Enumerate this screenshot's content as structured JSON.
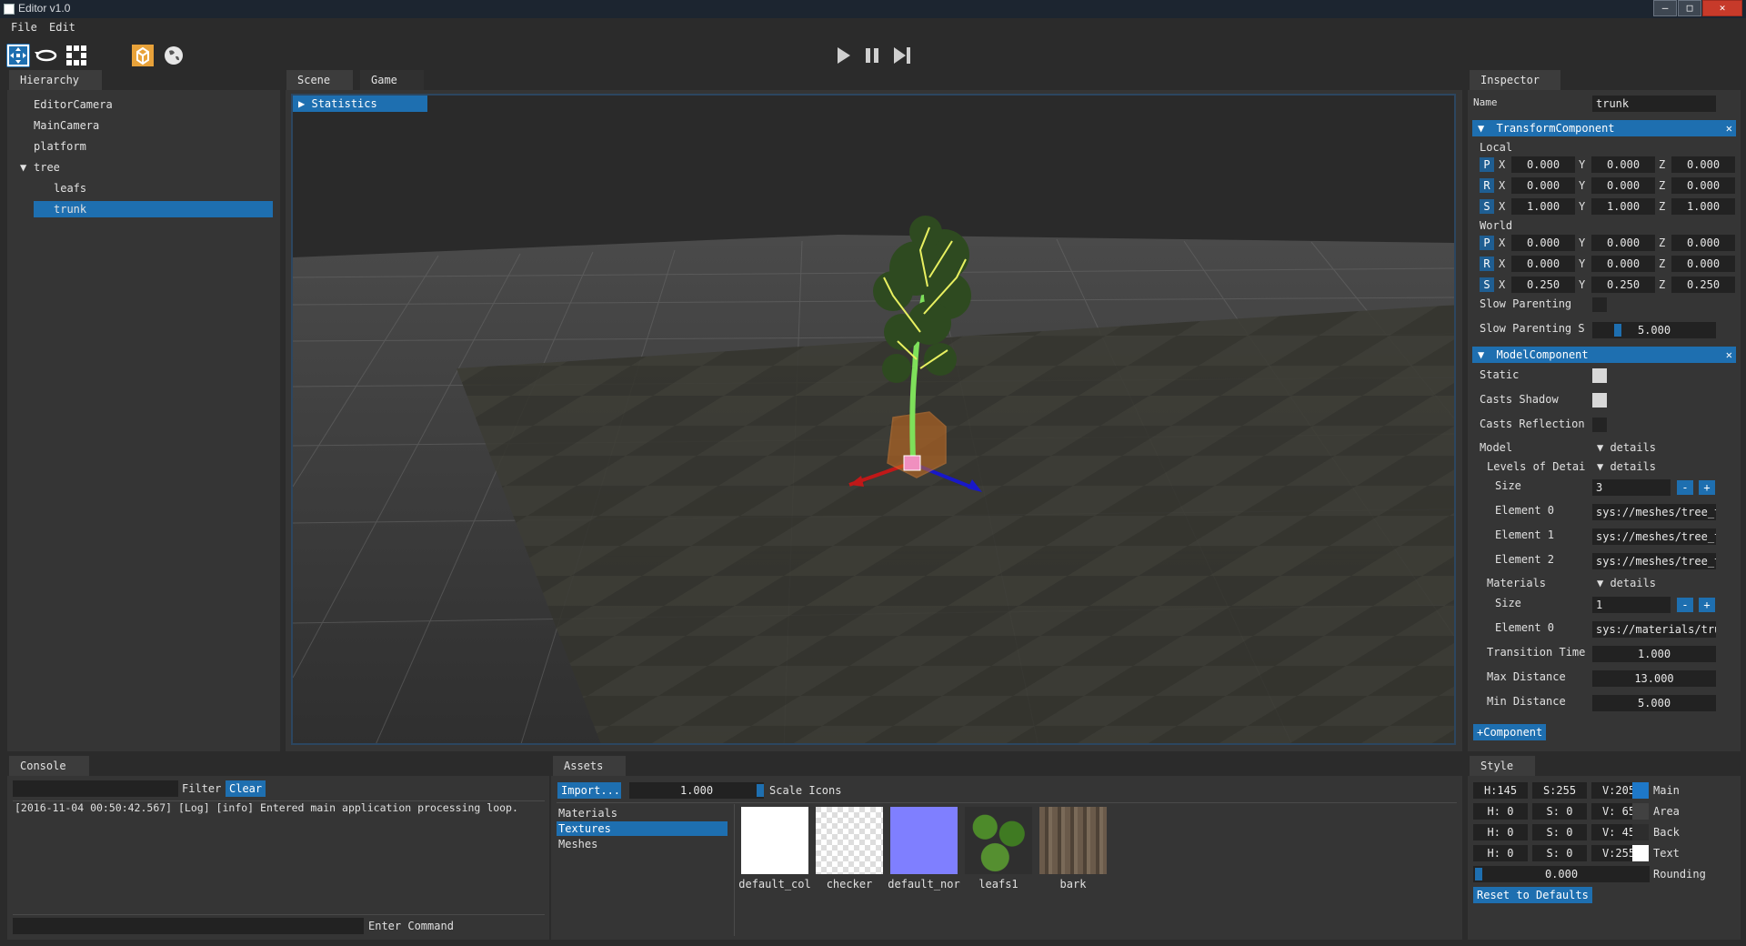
{
  "window": {
    "title": "Editor v1.0",
    "controls": [
      "–",
      "□",
      "✕"
    ]
  },
  "menu": {
    "items": [
      "File",
      "Edit"
    ]
  },
  "toolbar": {
    "tools": [
      "translate-icon",
      "rotate-icon",
      "scale-icon",
      "local-space-icon",
      "world-space-icon"
    ],
    "playback": [
      "play-icon",
      "pause-icon",
      "step-icon"
    ]
  },
  "hierarchy": {
    "tab": "Hierarchy",
    "items": [
      {
        "label": "EditorCamera",
        "depth": 0
      },
      {
        "label": "MainCamera",
        "depth": 0
      },
      {
        "label": "platform",
        "depth": 0
      },
      {
        "label": "tree",
        "depth": 0,
        "expanded": true
      },
      {
        "label": "leafs",
        "depth": 1
      },
      {
        "label": "trunk",
        "depth": 1,
        "selected": true
      }
    ],
    "expand_glyph": "▼"
  },
  "scene": {
    "tabs": [
      "Scene",
      "Game"
    ],
    "statistics_label": "Statistics",
    "statistics_glyph": "▶"
  },
  "inspector": {
    "tab": "Inspector",
    "name_label": "Name",
    "name_value": "trunk",
    "transform": {
      "title": "TransformComponent",
      "local_label": "Local",
      "world_label": "World",
      "axis": [
        "X",
        "Y",
        "Z"
      ],
      "rows_local": [
        {
          "key": "P",
          "values": [
            "0.000",
            "0.000",
            "0.000"
          ]
        },
        {
          "key": "R",
          "values": [
            "0.000",
            "0.000",
            "0.000"
          ]
        },
        {
          "key": "S",
          "values": [
            "1.000",
            "1.000",
            "1.000"
          ]
        }
      ],
      "rows_world": [
        {
          "key": "P",
          "values": [
            "0.000",
            "0.000",
            "0.000"
          ]
        },
        {
          "key": "R",
          "values": [
            "0.000",
            "0.000",
            "0.000"
          ]
        },
        {
          "key": "S",
          "values": [
            "0.250",
            "0.250",
            "0.250"
          ]
        }
      ],
      "slow_parenting_label": "Slow Parenting",
      "slow_parenting_speed_label": "Slow Parenting S",
      "slow_parenting_speed_value": "5.000"
    },
    "model": {
      "title": "ModelComponent",
      "static_label": "Static",
      "casts_shadow_label": "Casts Shadow",
      "casts_reflection_label": "Casts Reflection",
      "model_label": "Model",
      "details_label": "▼ details",
      "lod_label": "Levels of Detai",
      "size_label": "Size",
      "lod_size": "3",
      "lod_elements": [
        {
          "label": "Element 0",
          "value": "sys://meshes/tree_t"
        },
        {
          "label": "Element 1",
          "value": "sys://meshes/tree_t"
        },
        {
          "label": "Element 2",
          "value": "sys://meshes/tree_t"
        }
      ],
      "materials_label": "Materials",
      "materials_size": "1",
      "materials_elements": [
        {
          "label": "Element 0",
          "value": "sys://materials/tru"
        }
      ],
      "transition_time_label": "Transition Time",
      "transition_time_value": "1.000",
      "max_distance_label": "Max Distance",
      "max_distance_value": "13.000",
      "min_distance_label": "Min Distance",
      "min_distance_value": "5.000"
    },
    "add_component_label": "+Component"
  },
  "console": {
    "tab": "Console",
    "filter_label": "Filter",
    "clear_label": "Clear",
    "log_lines": [
      "[2016-11-04 00:50:42.567] [Log] [info] Entered main application processing loop."
    ],
    "command_label": "Enter Command"
  },
  "assets": {
    "tab": "Assets",
    "import_label": "Import...",
    "scale_value": "1.000",
    "scale_label": "Scale Icons",
    "categories": [
      "Materials",
      "Textures",
      "Meshes"
    ],
    "selected_category": "Textures",
    "textures": [
      {
        "label": "default_col",
        "icon": "white-texture"
      },
      {
        "label": "checker",
        "icon": "checker-texture"
      },
      {
        "label": "default_nor",
        "icon": "normal-texture"
      },
      {
        "label": "leafs1",
        "icon": "leaf-texture"
      },
      {
        "label": "bark",
        "icon": "bark-texture"
      }
    ]
  },
  "style": {
    "tab": "Style",
    "rows": [
      {
        "h": "H:145",
        "s": "S:255",
        "v": "V:205",
        "color": "#1e78c8",
        "label": "Main"
      },
      {
        "h": "H:  0",
        "s": "S:  0",
        "v": "V: 65",
        "color": "#414141",
        "label": "Area"
      },
      {
        "h": "H:  0",
        "s": "S:  0",
        "v": "V: 45",
        "color": "#2d2d2d",
        "label": "Back"
      },
      {
        "h": "H:  0",
        "s": "S:  0",
        "v": "V:255",
        "color": "#ffffff",
        "label": "Text"
      }
    ],
    "rounding_value": "0.000",
    "rounding_label": "Rounding",
    "reset_label": "Reset to Defaults"
  },
  "colors": {
    "accent": "#1e6fb0",
    "panel": "#353535",
    "background": "#2b2b2b"
  }
}
